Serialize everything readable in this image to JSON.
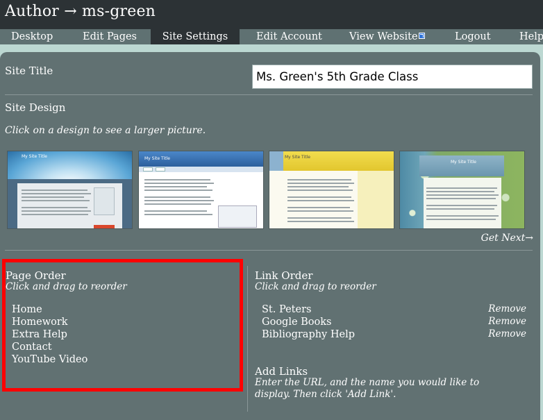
{
  "header": {
    "title": "Author → ms-green"
  },
  "nav": {
    "items": [
      {
        "label": "Desktop"
      },
      {
        "label": "Edit Pages"
      },
      {
        "label": "Site Settings"
      },
      {
        "label": "Edit Account"
      },
      {
        "label": "View Website"
      },
      {
        "label": "Logout"
      },
      {
        "label": "Help"
      }
    ],
    "active": "Site Settings"
  },
  "site_title": {
    "label": "Site Title",
    "value": "Ms. Green's 5th Grade Class"
  },
  "site_design": {
    "label": "Site Design",
    "hint": "Click on a design to see a larger picture.",
    "thumbnails": [
      {
        "title": "My Site Title",
        "icon": "sunburst-theme-thumbnail"
      },
      {
        "title": "My Site Title",
        "icon": "blue-header-theme-thumbnail"
      },
      {
        "title": "My Site Title",
        "icon": "yellow-theme-thumbnail"
      },
      {
        "title": "My Site Title",
        "icon": "green-leaf-theme-thumbnail"
      }
    ],
    "get_next": "Get Next→"
  },
  "page_order": {
    "label": "Page Order",
    "hint": "Click and drag to reorder",
    "items": [
      "Home",
      "Homework",
      "Extra Help",
      "Contact",
      "YouTube Video"
    ]
  },
  "link_order": {
    "label": "Link Order",
    "hint": "Click and drag to reorder",
    "remove_label": "Remove",
    "items": [
      "St. Peters",
      "Google Books",
      "Bibliography Help"
    ]
  },
  "add_links": {
    "label": "Add Links",
    "hint_line1": "Enter the URL, and the name you would like to",
    "hint_line2": "display. Then click 'Add Link'."
  },
  "colors": {
    "header_bg": "#2c3235",
    "nav_bg": "#5f7172",
    "panel_bg": "#617172",
    "page_bg": "#bcd8d2",
    "highlight_border": "#ff0000"
  }
}
